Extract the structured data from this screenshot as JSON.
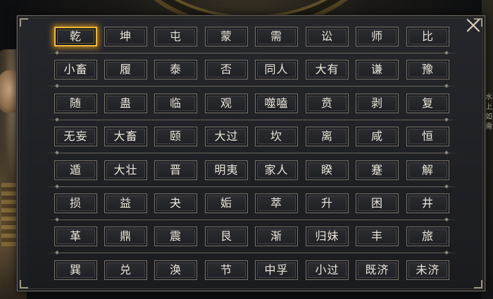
{
  "side_note": [
    "水",
    "上",
    "如",
    "需"
  ],
  "close_icon": "close-x-icon",
  "accent_color": "#f0b83a",
  "selected": "乾",
  "hexagram_rows": [
    [
      "乾",
      "坤",
      "屯",
      "蒙",
      "需",
      "讼",
      "师",
      "比"
    ],
    [
      "小畜",
      "履",
      "泰",
      "否",
      "同人",
      "大有",
      "谦",
      "豫"
    ],
    [
      "随",
      "蛊",
      "临",
      "观",
      "噬嗑",
      "贲",
      "剥",
      "复"
    ],
    [
      "无妄",
      "大畜",
      "颐",
      "大过",
      "坎",
      "离",
      "咸",
      "恒"
    ],
    [
      "遁",
      "大壮",
      "晋",
      "明夷",
      "家人",
      "睽",
      "蹇",
      "解"
    ],
    [
      "损",
      "益",
      "夬",
      "姤",
      "萃",
      "升",
      "困",
      "井"
    ],
    [
      "革",
      "鼎",
      "震",
      "艮",
      "渐",
      "归妹",
      "丰",
      "旅"
    ],
    [
      "巽",
      "兑",
      "涣",
      "节",
      "中孚",
      "小过",
      "既济",
      "未济"
    ]
  ]
}
